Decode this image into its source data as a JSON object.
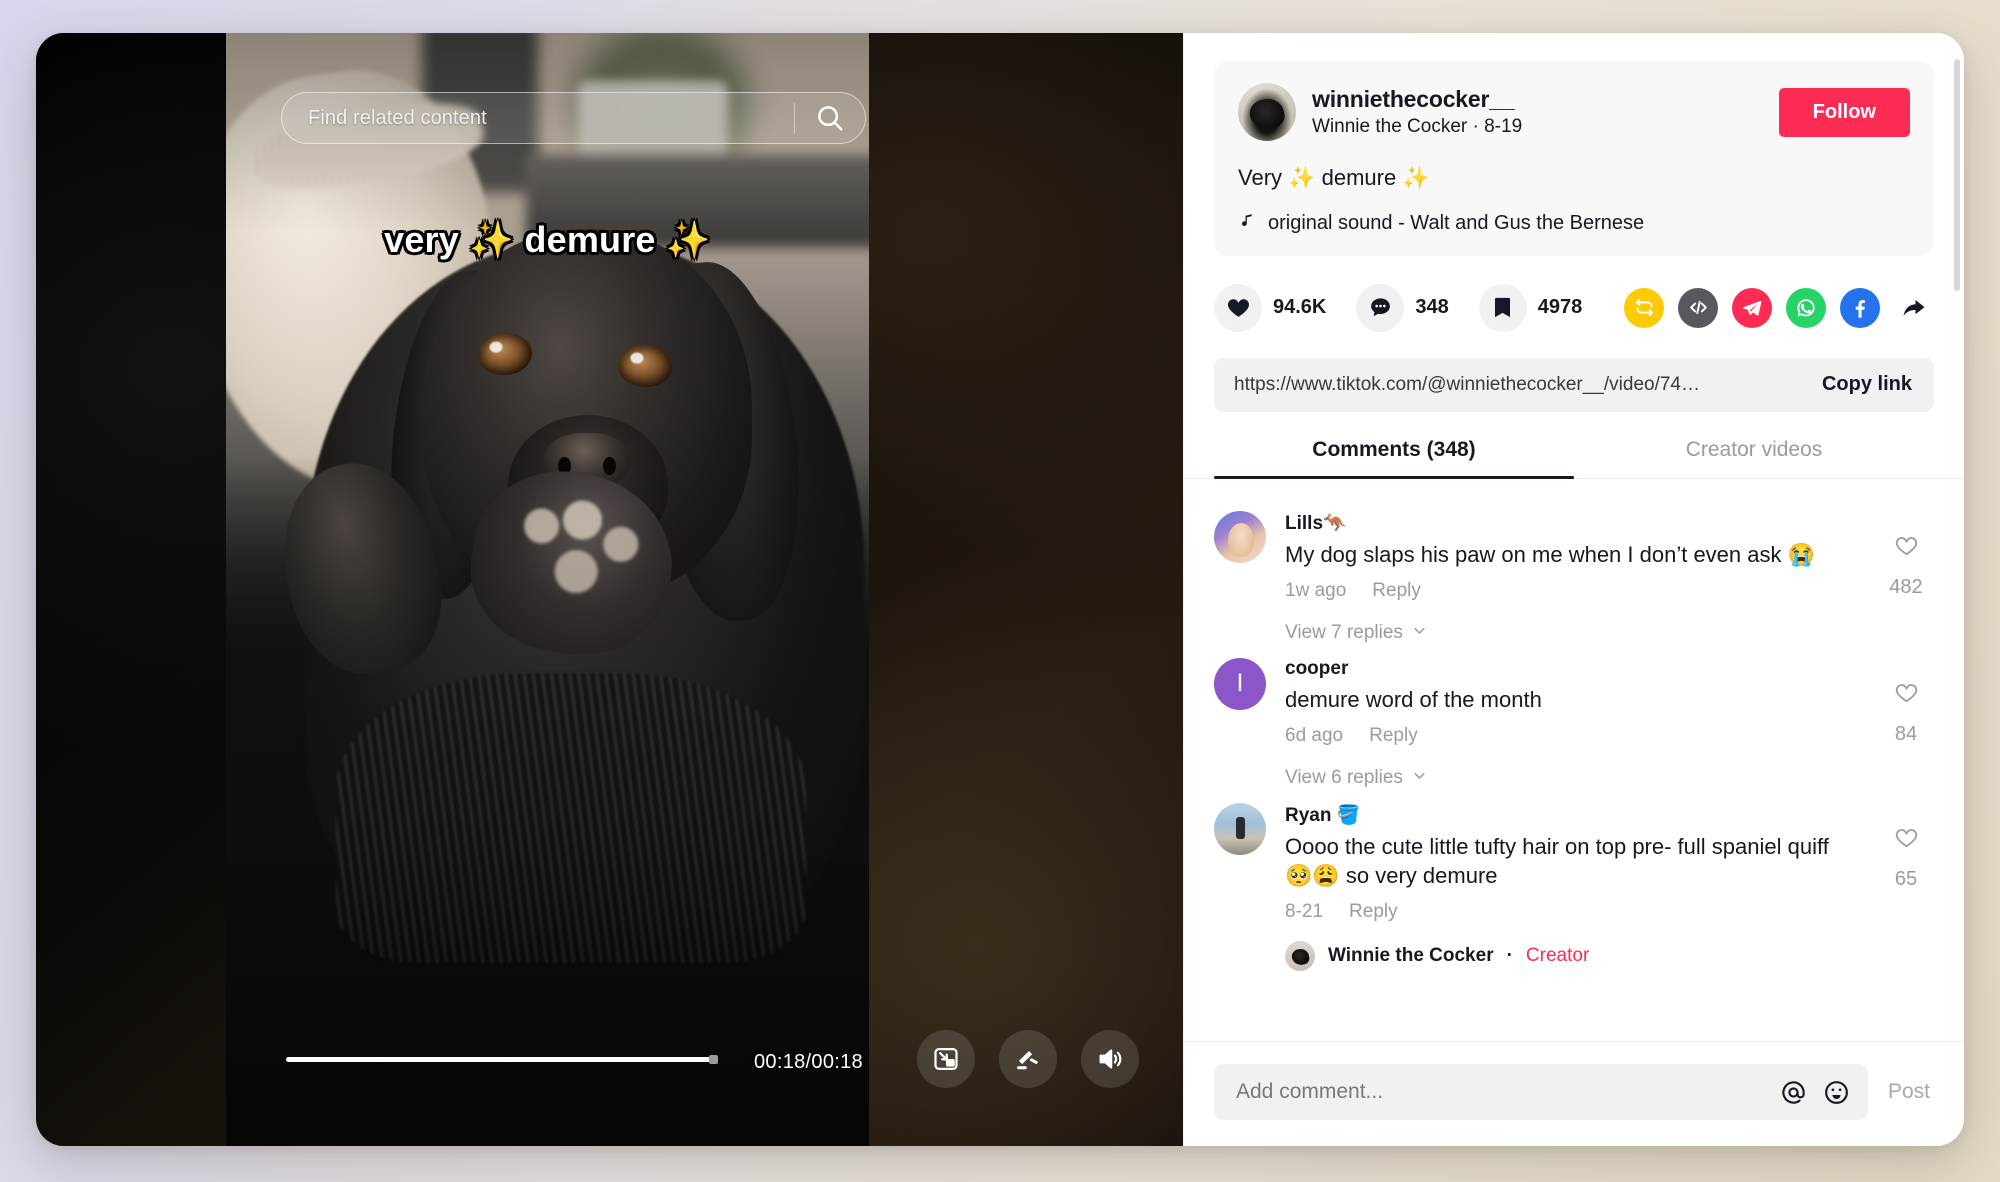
{
  "video": {
    "search_placeholder": "Find related content",
    "search_icon": "search-icon",
    "caption_overlay": "very ✨ demure ✨",
    "time_label": "00:18/00:18",
    "progress_percent": 99,
    "controls": [
      {
        "name": "picture-in-picture-icon",
        "label": "Picture in picture"
      },
      {
        "name": "clear-mode-icon",
        "label": "Clear mode"
      },
      {
        "name": "volume-icon",
        "label": "Volume"
      }
    ]
  },
  "author": {
    "handle": "winniethecocker__",
    "nickname": "Winnie the Cocker",
    "date": "8-19",
    "subtitle": "Winnie the Cocker · 8-19",
    "follow_label": "Follow",
    "follow_color": "#fe2c55",
    "description": "Very ✨ demure ✨",
    "music_icon": "music-note-icon",
    "music": "original sound - Walt and Gus the Bernese"
  },
  "engagement": {
    "like_count": "94.6K",
    "comment_count": "348",
    "bookmark_count": "4978",
    "share_icons": [
      {
        "name": "repost-icon",
        "label": "Repost",
        "color": "#fdcb00"
      },
      {
        "name": "embed-icon",
        "label": "Embed",
        "color": "#58585e"
      },
      {
        "name": "telegram-icon",
        "label": "Telegram",
        "color": "#fe2c55"
      },
      {
        "name": "whatsapp-icon",
        "label": "WhatsApp",
        "color": "#25d366"
      },
      {
        "name": "facebook-icon",
        "label": "Facebook",
        "color": "#2573ec"
      },
      {
        "name": "share-arrow-icon",
        "label": "Share to",
        "color": "#161823"
      }
    ]
  },
  "copy_link": {
    "url": "https://www.tiktok.com/@winniethecocker__/video/74…",
    "button_label": "Copy link"
  },
  "tabs": [
    {
      "label": "Comments (348)",
      "active": true
    },
    {
      "label": "Creator videos",
      "active": false
    }
  ],
  "comments": [
    {
      "name": "Lills🦘",
      "text": "My dog slaps his paw on me when I don’t even ask 😭",
      "time": "1w ago",
      "reply_label": "Reply",
      "likes": "482",
      "replies_label": "View 7 replies"
    },
    {
      "name": "cooper",
      "avatar_initial": "I",
      "text": "demure word of the month",
      "time": "6d ago",
      "reply_label": "Reply",
      "likes": "84",
      "replies_label": "View 6 replies"
    },
    {
      "name": "Ryan 🪣",
      "text": "Oooo the cute little tufty hair on top pre- full spaniel quiff 🥺😩 so very demure",
      "time": "8-21",
      "reply_label": "Reply",
      "likes": "65",
      "creator_reply_name": "Winnie the Cocker",
      "creator_reply_separator": "·",
      "creator_reply_badge": "Creator"
    }
  ],
  "composer": {
    "placeholder": "Add comment...",
    "value": "",
    "mention_icon": "at-mention-icon",
    "emoji_icon": "emoji-icon",
    "post_label": "Post"
  }
}
